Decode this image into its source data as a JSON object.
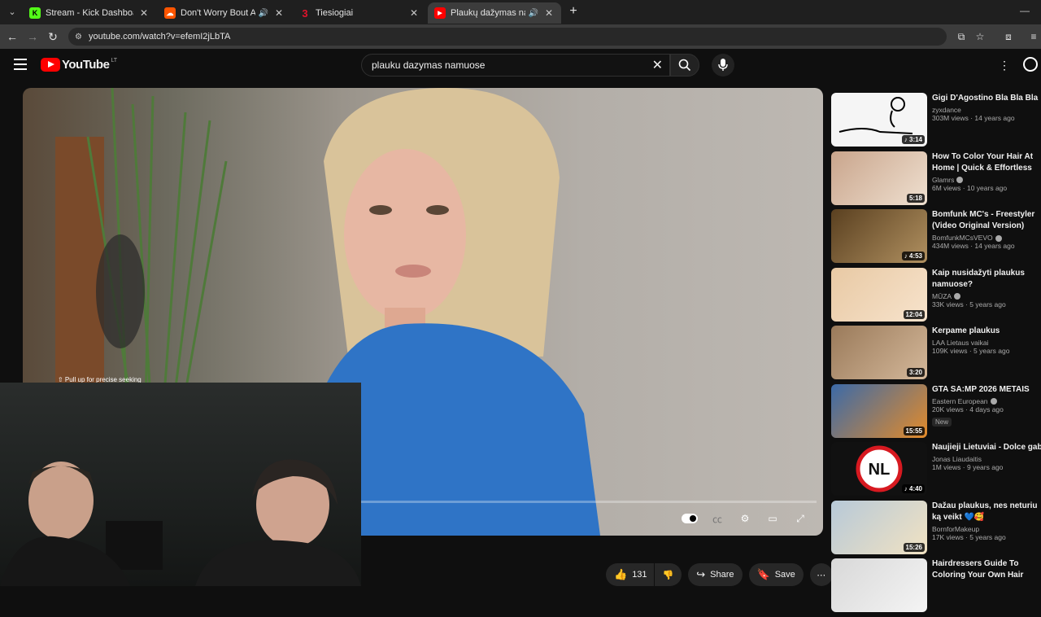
{
  "browser": {
    "tabs": [
      {
        "title": "Stream - Kick Dashboard",
        "favicon_color": "#53fc18",
        "favicon_glyph": "K",
        "audio": false
      },
      {
        "title": "Don't Worry Bout A Thing, (",
        "favicon_color": "#ff5500",
        "favicon_glyph": "☁",
        "audio": true
      },
      {
        "title": "Tiesiogiai",
        "favicon_color": "#e0132b",
        "favicon_glyph": "3",
        "audio": false
      },
      {
        "title": "Plaukų dažymas namuose!",
        "favicon_color": "#ff0000",
        "favicon_glyph": "▶",
        "audio": true,
        "active": true
      }
    ],
    "url": "youtube.com/watch?v=efemI2jLbTA"
  },
  "youtube": {
    "logo": "YouTube",
    "country": "LT",
    "search_query": "plauku dazymas namuose",
    "seek_hint": "⇧ Pull up for precise seeking",
    "likes": "131",
    "share_label": "Share",
    "save_label": "Save"
  },
  "recommendations": [
    {
      "title": "Gigi D'Agostino Bla Bla Bla",
      "channel": "zyxdance",
      "verified": false,
      "stats": "303M views · 14 years ago",
      "duration": "♪ 3:14",
      "thumb": "#f5f5f5"
    },
    {
      "title": "How To Color Your Hair At Home | Quick & Effortless",
      "channel": "Glamrs",
      "verified": true,
      "stats": "6M views · 10 years ago",
      "duration": "5:18",
      "thumb": "#c9a58c"
    },
    {
      "title": "Bomfunk MC's - Freestyler (Video Original Version)",
      "channel": "BomfunkMCsVEVO",
      "verified": true,
      "stats": "434M views · 14 years ago",
      "duration": "♪ 4:53",
      "thumb": "#8a6a3a"
    },
    {
      "title": "Kaip nusidažyti plaukus namuose?",
      "channel": "MŪZA",
      "verified": true,
      "stats": "33K views · 5 years ago",
      "duration": "12:04",
      "thumb": "#e8c9a4"
    },
    {
      "title": "Kerpame plaukus",
      "channel": "LAA Lietaus vaikai",
      "verified": false,
      "stats": "109K views · 5 years ago",
      "duration": "3:20",
      "thumb": "#9a7a5a"
    },
    {
      "title": "GTA SA:MP 2026 METAIS",
      "channel": "Eastern European",
      "verified": true,
      "stats": "20K views · 4 days ago",
      "duration": "15:55",
      "badge": "New",
      "thumb": "#3b6aa8"
    },
    {
      "title": "Naujieji Lietuviai - Dolce gabana",
      "channel": "Jonas Liaudaitis",
      "verified": false,
      "stats": "1M views · 9 years ago",
      "duration": "♪ 4:40",
      "thumb": "#111111"
    },
    {
      "title": "Dažau plaukus, nes neturiu ką veikt 💙🥰",
      "channel": "BornforMakeup",
      "verified": false,
      "stats": "17K views · 5 years ago",
      "duration": "15:26",
      "thumb": "#b7c9d8"
    },
    {
      "title": "Hairdressers Guide To Coloring Your Own Hair And Not Ruinin...",
      "channel": "",
      "verified": false,
      "stats": "",
      "duration": "",
      "thumb": "#d8d8d8"
    }
  ]
}
